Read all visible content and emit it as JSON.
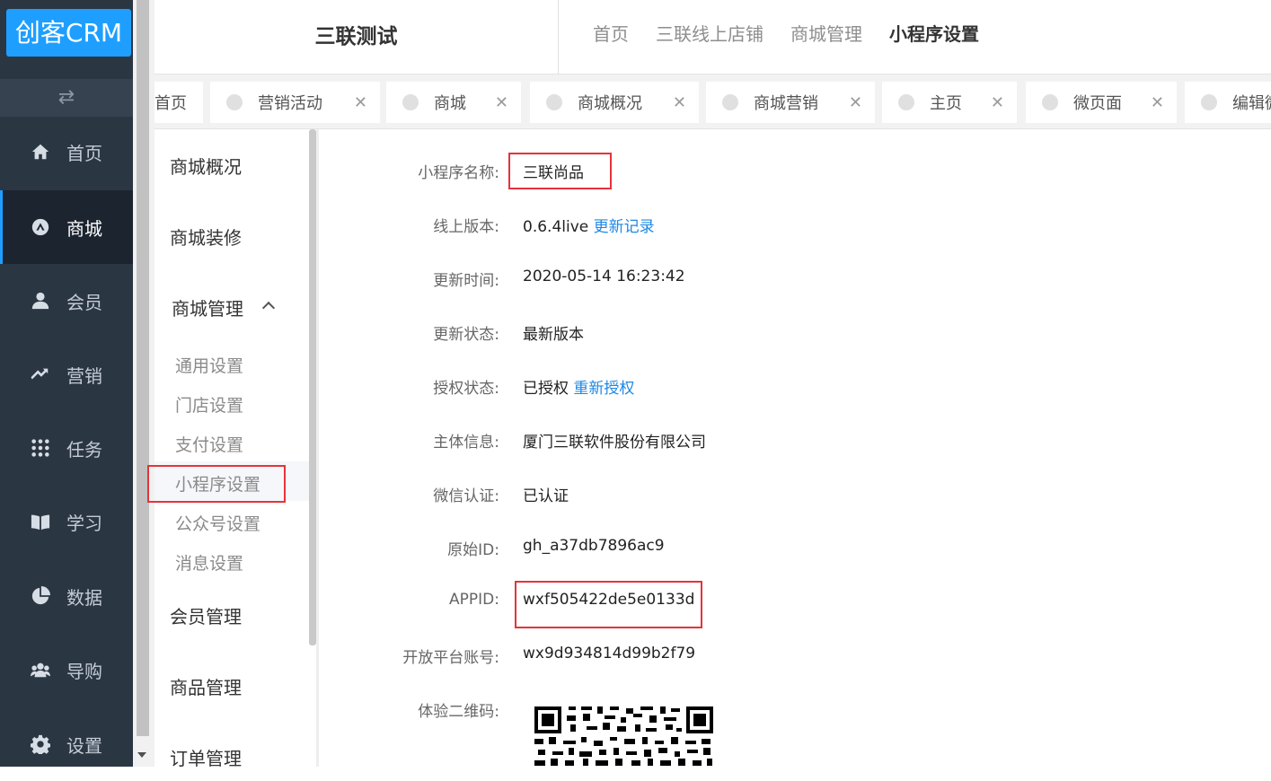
{
  "app": {
    "logo": "创客CRM"
  },
  "sidebar": {
    "items": [
      {
        "label": "首页",
        "icon": "home-icon"
      },
      {
        "label": "商城",
        "icon": "shop-icon"
      },
      {
        "label": "会员",
        "icon": "user-icon"
      },
      {
        "label": "营销",
        "icon": "trend-icon"
      },
      {
        "label": "任务",
        "icon": "grid-icon"
      },
      {
        "label": "学习",
        "icon": "book-icon"
      },
      {
        "label": "数据",
        "icon": "pie-chart-icon"
      },
      {
        "label": "导购",
        "icon": "group-icon"
      },
      {
        "label": "设置",
        "icon": "gear-icon"
      }
    ],
    "active_index": 1
  },
  "header": {
    "title": "三联测试",
    "nav": [
      "首页",
      "三联线上店铺",
      "商城管理",
      "小程序设置"
    ]
  },
  "tabs": [
    {
      "label": "首页"
    },
    {
      "label": "营销活动"
    },
    {
      "label": "商城"
    },
    {
      "label": "商城概况"
    },
    {
      "label": "商城营销"
    },
    {
      "label": "主页"
    },
    {
      "label": "微页面"
    },
    {
      "label": "编辑微"
    }
  ],
  "submenu": {
    "sections": [
      "商城概况",
      "商城装修",
      "商城管理",
      "会员管理",
      "商品管理",
      "订单管理"
    ],
    "mall_manage_items": [
      "通用设置",
      "门店设置",
      "支付设置",
      "小程序设置",
      "公众号设置",
      "消息设置"
    ]
  },
  "detail": {
    "rows": [
      {
        "label": "小程序名称:",
        "value": "三联尚品"
      },
      {
        "label": "线上版本:",
        "value": "0.6.4live",
        "link": "更新记录"
      },
      {
        "label": "更新时间:",
        "value": "2020-05-14 16:23:42"
      },
      {
        "label": "更新状态:",
        "value": "最新版本"
      },
      {
        "label": "授权状态:",
        "value": "已授权",
        "link": "重新授权"
      },
      {
        "label": "主体信息:",
        "value": "厦门三联软件股份有限公司"
      },
      {
        "label": "微信认证:",
        "value": "已认证"
      },
      {
        "label": "原始ID:",
        "value": "gh_a37db7896ac9"
      },
      {
        "label": "APPID:",
        "value": "wxf505422de5e0133d"
      },
      {
        "label": "开放平台账号:",
        "value": "wx9d934814d99b2f79"
      },
      {
        "label": "体验二维码:",
        "value": ""
      }
    ]
  },
  "colors": {
    "accent": "#1e9fff",
    "sidebar_bg": "#2b3643",
    "highlight": "#e5333a",
    "link": "#1e88e5"
  }
}
